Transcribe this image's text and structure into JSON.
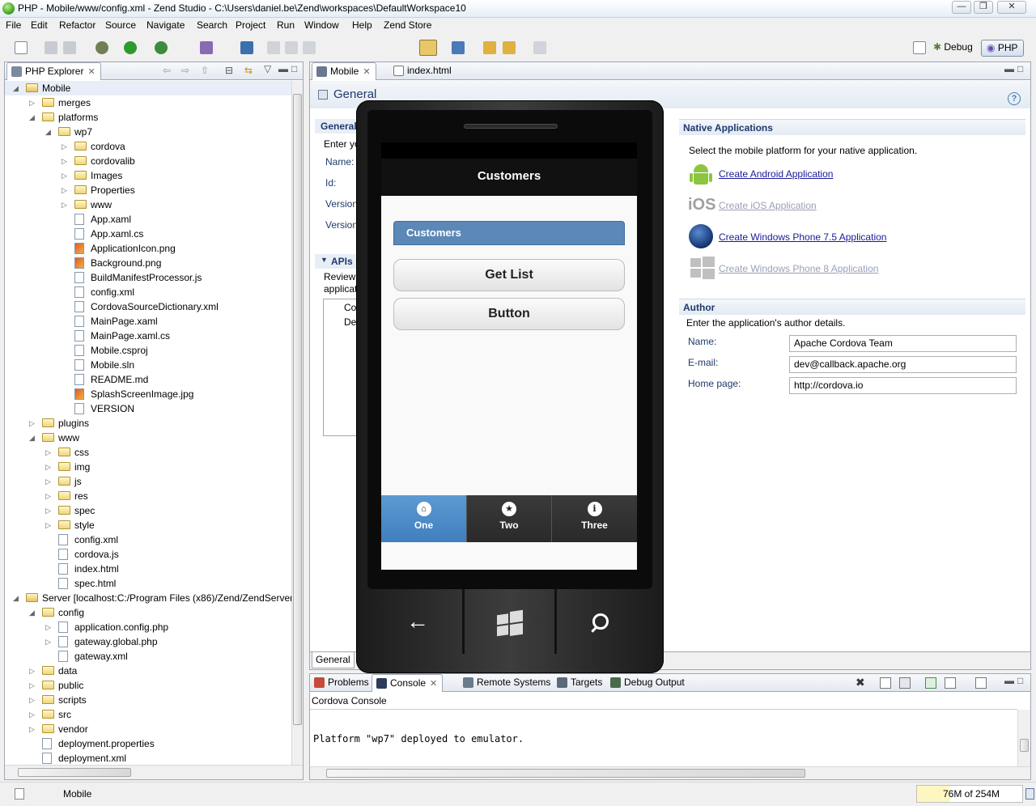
{
  "window": {
    "title": "PHP - Mobile/www/config.xml - Zend Studio - C:\\Users\\daniel.be\\Zend\\workspaces\\DefaultWorkspace10"
  },
  "menu": [
    "File",
    "Edit",
    "Refactor",
    "Source",
    "Navigate",
    "Search",
    "Project",
    "Run",
    "Window",
    "Help",
    "Zend Store"
  ],
  "perspectives": {
    "debug": "Debug",
    "php": "PHP"
  },
  "explorer": {
    "tab": "PHP Explorer",
    "tree": [
      {
        "label": "Mobile",
        "depth": 0,
        "tw": "◢",
        "icon": "project"
      },
      {
        "label": "merges",
        "depth": 1,
        "tw": "▷",
        "icon": "folder"
      },
      {
        "label": "platforms",
        "depth": 1,
        "tw": "◢",
        "icon": "folder"
      },
      {
        "label": "wp7",
        "depth": 2,
        "tw": "◢",
        "icon": "folder"
      },
      {
        "label": "cordova",
        "depth": 3,
        "tw": "▷",
        "icon": "folder"
      },
      {
        "label": "cordovalib",
        "depth": 3,
        "tw": "▷",
        "icon": "folder"
      },
      {
        "label": "Images",
        "depth": 3,
        "tw": "▷",
        "icon": "folder"
      },
      {
        "label": "Properties",
        "depth": 3,
        "tw": "▷",
        "icon": "folder"
      },
      {
        "label": "www",
        "depth": 3,
        "tw": "▷",
        "icon": "folder"
      },
      {
        "label": "App.xaml",
        "depth": 3,
        "tw": "",
        "icon": "file"
      },
      {
        "label": "App.xaml.cs",
        "depth": 3,
        "tw": "",
        "icon": "file"
      },
      {
        "label": "ApplicationIcon.png",
        "depth": 3,
        "tw": "",
        "icon": "image"
      },
      {
        "label": "Background.png",
        "depth": 3,
        "tw": "",
        "icon": "image"
      },
      {
        "label": "BuildManifestProcessor.js",
        "depth": 3,
        "tw": "",
        "icon": "file"
      },
      {
        "label": "config.xml",
        "depth": 3,
        "tw": "",
        "icon": "file"
      },
      {
        "label": "CordovaSourceDictionary.xml",
        "depth": 3,
        "tw": "",
        "icon": "file"
      },
      {
        "label": "MainPage.xaml",
        "depth": 3,
        "tw": "",
        "icon": "file"
      },
      {
        "label": "MainPage.xaml.cs",
        "depth": 3,
        "tw": "",
        "icon": "file"
      },
      {
        "label": "Mobile.csproj",
        "depth": 3,
        "tw": "",
        "icon": "file"
      },
      {
        "label": "Mobile.sln",
        "depth": 3,
        "tw": "",
        "icon": "file"
      },
      {
        "label": "README.md",
        "depth": 3,
        "tw": "",
        "icon": "file"
      },
      {
        "label": "SplashScreenImage.jpg",
        "depth": 3,
        "tw": "",
        "icon": "image"
      },
      {
        "label": "VERSION",
        "depth": 3,
        "tw": "",
        "icon": "file"
      },
      {
        "label": "plugins",
        "depth": 1,
        "tw": "▷",
        "icon": "folder"
      },
      {
        "label": "www",
        "depth": 1,
        "tw": "◢",
        "icon": "folder"
      },
      {
        "label": "css",
        "depth": 2,
        "tw": "▷",
        "icon": "folder"
      },
      {
        "label": "img",
        "depth": 2,
        "tw": "▷",
        "icon": "folder"
      },
      {
        "label": "js",
        "depth": 2,
        "tw": "▷",
        "icon": "folder"
      },
      {
        "label": "res",
        "depth": 2,
        "tw": "▷",
        "icon": "folder"
      },
      {
        "label": "spec",
        "depth": 2,
        "tw": "▷",
        "icon": "folder"
      },
      {
        "label": "style",
        "depth": 2,
        "tw": "▷",
        "icon": "folder"
      },
      {
        "label": "config.xml",
        "depth": 2,
        "tw": "",
        "icon": "file"
      },
      {
        "label": "cordova.js",
        "depth": 2,
        "tw": "",
        "icon": "file"
      },
      {
        "label": "index.html",
        "depth": 2,
        "tw": "",
        "icon": "file"
      },
      {
        "label": "spec.html",
        "depth": 2,
        "tw": "",
        "icon": "file"
      },
      {
        "label": "Server  [localhost:C:/Program Files (x86)/Zend/ZendServer/",
        "depth": 0,
        "tw": "◢",
        "icon": "project"
      },
      {
        "label": "config",
        "depth": 1,
        "tw": "◢",
        "icon": "folder"
      },
      {
        "label": "application.config.php",
        "depth": 2,
        "tw": "▷",
        "icon": "file"
      },
      {
        "label": "gateway.global.php",
        "depth": 2,
        "tw": "▷",
        "icon": "file"
      },
      {
        "label": "gateway.xml",
        "depth": 2,
        "tw": "",
        "icon": "file"
      },
      {
        "label": "data",
        "depth": 1,
        "tw": "▷",
        "icon": "folder"
      },
      {
        "label": "public",
        "depth": 1,
        "tw": "▷",
        "icon": "folder"
      },
      {
        "label": "scripts",
        "depth": 1,
        "tw": "▷",
        "icon": "folder"
      },
      {
        "label": "src",
        "depth": 1,
        "tw": "▷",
        "icon": "folder"
      },
      {
        "label": "vendor",
        "depth": 1,
        "tw": "▷",
        "icon": "folder"
      },
      {
        "label": "deployment.properties",
        "depth": 1,
        "tw": "",
        "icon": "file"
      },
      {
        "label": "deployment.xml",
        "depth": 1,
        "tw": "",
        "icon": "file"
      }
    ]
  },
  "editor": {
    "tabs": [
      "Mobile",
      "index.html"
    ],
    "title": "General",
    "general_section": "General",
    "general_intro": "Enter yo",
    "fields_left": [
      "Name:",
      "Id:",
      "Version",
      "Version"
    ],
    "apis_section": "APIs",
    "apis_text": [
      "Review",
      "applicat"
    ],
    "apis_list": [
      "Co",
      "Dev"
    ],
    "bottom_tab": "General",
    "native": {
      "title": "Native Applications",
      "intro": "Select the mobile platform for your native application.",
      "links": [
        {
          "label": "Create Android Application",
          "enabled": true,
          "icon": "android-icon"
        },
        {
          "label": "Create iOS Application",
          "enabled": false,
          "icon": "ios-icon"
        },
        {
          "label": "Create Windows Phone 7.5 Application",
          "enabled": true,
          "icon": "windows-phone-icon"
        },
        {
          "label": "Create Windows Phone 8 Application",
          "enabled": false,
          "icon": "windows8-icon"
        }
      ],
      "ios_glyph": "iOS"
    },
    "author": {
      "title": "Author",
      "intro": "Enter the application's author details.",
      "rows": [
        {
          "label": "Name:",
          "value": "Apache Cordova Team"
        },
        {
          "label": "E-mail:",
          "value": "dev@callback.apache.org"
        },
        {
          "label": "Home page:",
          "value": "http://cordova.io"
        }
      ]
    }
  },
  "phone": {
    "header": "Customers",
    "list_header": "Customers",
    "buttons": [
      "Get List",
      "Button"
    ],
    "nav": [
      {
        "label": "One",
        "icon": "home-icon",
        "glyph": "⌂",
        "active": true
      },
      {
        "label": "Two",
        "icon": "star-icon",
        "glyph": "★",
        "active": false
      },
      {
        "label": "Three",
        "icon": "info-icon",
        "glyph": "i",
        "active": false
      }
    ],
    "accent": "#4f8cc4"
  },
  "console": {
    "tabs": [
      "Problems",
      "Console",
      "Remote Systems",
      "Targets",
      "Debug Output"
    ],
    "title": "Cordova Console",
    "output": "Platform \"wp7\" deployed to emulator."
  },
  "status": {
    "selection": "Mobile",
    "memory": "76M of 254M"
  }
}
